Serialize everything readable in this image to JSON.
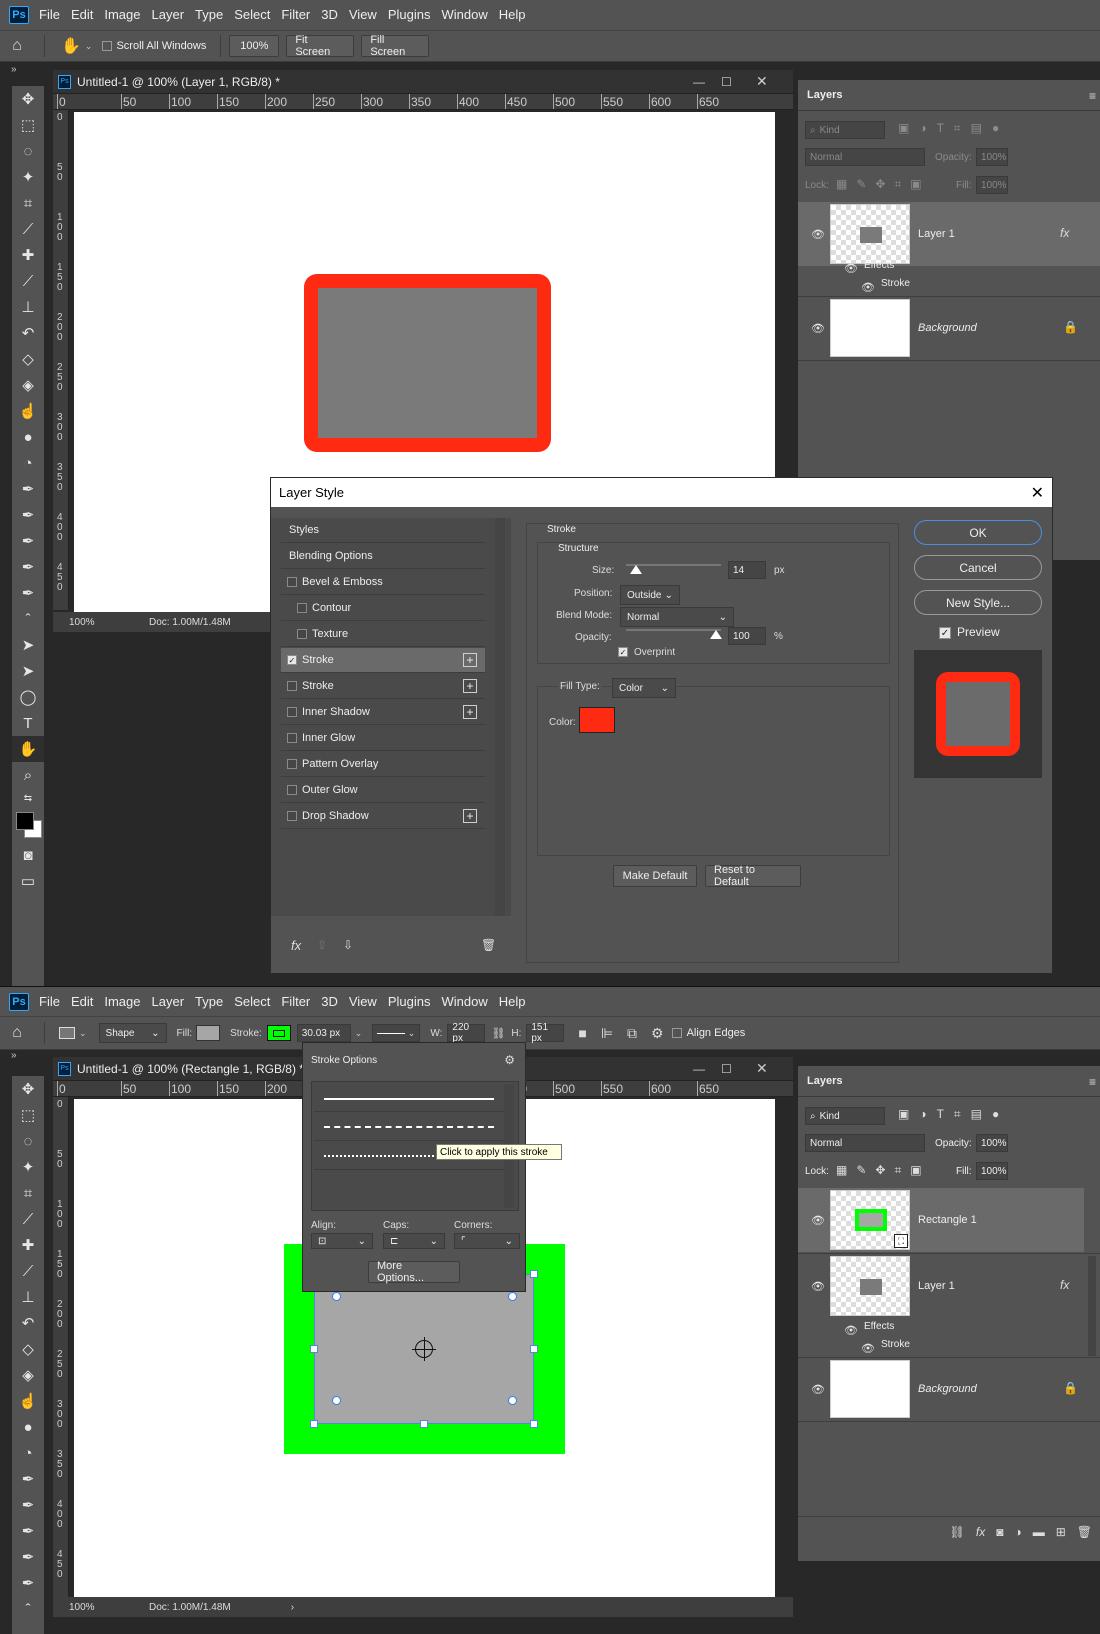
{
  "app": {
    "logo": "Ps"
  },
  "menu": [
    "File",
    "Edit",
    "Image",
    "Layer",
    "Type",
    "Select",
    "Filter",
    "3D",
    "View",
    "Plugins",
    "Window",
    "Help"
  ],
  "top": {
    "options": {
      "scroll_all": "Scroll All Windows",
      "zoom": "100%",
      "fit": "Fit Screen",
      "fill": "Fill Screen"
    },
    "doc_title": "Untitled-1 @ 100% (Layer 1, RGB/8) *",
    "ruler_h": [
      "0",
      "50",
      "100",
      "150",
      "200",
      "250",
      "300",
      "350",
      "400",
      "450",
      "500",
      "550",
      "600",
      "650"
    ],
    "ruler_v": [
      "0",
      "5\n0",
      "1\n0\n0",
      "1\n5\n0",
      "2\n0\n0",
      "2\n5\n0",
      "3\n0\n0",
      "3\n5\n0",
      "4\n0\n0",
      "4\n5\n0"
    ],
    "status": {
      "zoom": "100%",
      "doc": "Doc: 1.00M/1.48M"
    },
    "layers": {
      "tab": "Layers",
      "kind": "Kind",
      "blend": "Normal",
      "opacity_label": "Opacity:",
      "opacity": "100%",
      "lock_label": "Lock:",
      "fill_label": "Fill:",
      "fill": "100%",
      "items": [
        {
          "name": "Layer 1",
          "fx": "fx",
          "effects": "Effects",
          "effect": "Stroke"
        },
        {
          "name": "Background"
        }
      ]
    }
  },
  "dialog": {
    "title": "Layer Style",
    "styles": [
      "Styles",
      "Blending Options",
      "Bevel & Emboss",
      "Contour",
      "Texture",
      "Stroke",
      "Stroke",
      "Inner Shadow",
      "Inner Glow",
      "Pattern Overlay",
      "Outer Glow",
      "Drop Shadow"
    ],
    "stroke": {
      "section": "Stroke",
      "structure": "Structure",
      "size_label": "Size:",
      "size": "14",
      "size_unit": "px",
      "position_label": "Position:",
      "position": "Outside",
      "blend_label": "Blend Mode:",
      "blend": "Normal",
      "opacity_label": "Opacity:",
      "opacity": "100",
      "opacity_unit": "%",
      "overprint": "Overprint",
      "filltype_label": "Fill Type:",
      "filltype": "Color",
      "color_label": "Color:",
      "color": "#ff2a12",
      "make_default": "Make Default",
      "reset_default": "Reset to Default"
    },
    "buttons": {
      "ok": "OK",
      "cancel": "Cancel",
      "new_style": "New Style...",
      "preview": "Preview"
    },
    "bottom_icons": {
      "fx": "fx"
    }
  },
  "bottom": {
    "options": {
      "mode": "Shape",
      "fill_label": "Fill:",
      "stroke_label": "Stroke:",
      "stroke_width": "30.03 px",
      "w_label": "W:",
      "w": "220 px",
      "h_label": "H:",
      "h": "151 px",
      "align_edges": "Align Edges"
    },
    "doc_title": "Untitled-1 @ 100% (Rectangle 1, RGB/8) *",
    "ruler_h": [
      "0",
      "50",
      "100",
      "150",
      "200",
      "450",
      "500",
      "550",
      "600",
      "650"
    ],
    "ruler_v": [
      "0",
      "5\n0",
      "1\n0\n0",
      "1\n5\n0",
      "2\n0\n0",
      "2\n5\n0",
      "3\n0\n0",
      "3\n5\n0",
      "4\n0\n0",
      "4\n5\n0"
    ],
    "status": {
      "zoom": "100%",
      "doc": "Doc: 1.00M/1.48M"
    },
    "stroke_options": {
      "title": "Stroke Options",
      "tooltip": "Click to apply this stroke",
      "align_label": "Align:",
      "caps_label": "Caps:",
      "corners_label": "Corners:",
      "more": "More Options..."
    },
    "layers": {
      "tab": "Layers",
      "kind": "Kind",
      "blend": "Normal",
      "opacity_label": "Opacity:",
      "opacity": "100%",
      "lock_label": "Lock:",
      "fill_label": "Fill:",
      "fill": "100%",
      "items": [
        {
          "name": "Rectangle 1"
        },
        {
          "name": "Layer 1",
          "fx": "fx",
          "effects": "Effects",
          "effect": "Stroke"
        },
        {
          "name": "Background"
        }
      ]
    }
  },
  "colors": {
    "red": "#ff2a12",
    "green": "#00ff00",
    "gray": "#7a7a7a",
    "lightgray": "#a6a6a6"
  }
}
